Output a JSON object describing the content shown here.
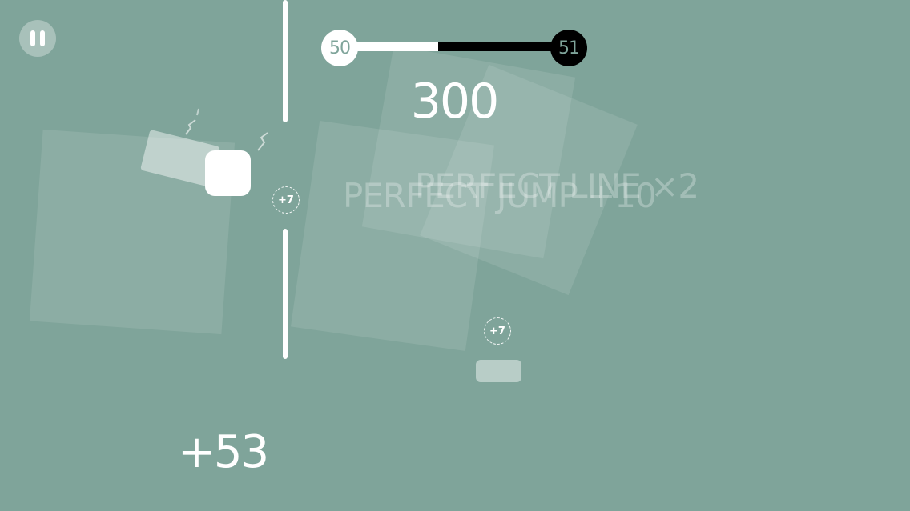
{
  "colors": {
    "background": "#7fa49a",
    "player": "#ffffff",
    "progress_done": "#ffffff",
    "progress_remaining": "#000000"
  },
  "hud": {
    "pause_icon": "pause-icon",
    "level_current": "50",
    "level_next": "51",
    "level_progress": 0.43,
    "score": "300"
  },
  "bonuses": [
    {
      "label": "+7"
    },
    {
      "label": "+7"
    }
  ],
  "messages": {
    "perfect_line": "PERFECT LINE ×2",
    "perfect_jump": "PERFECT JUMP +10"
  },
  "combo": "+53"
}
